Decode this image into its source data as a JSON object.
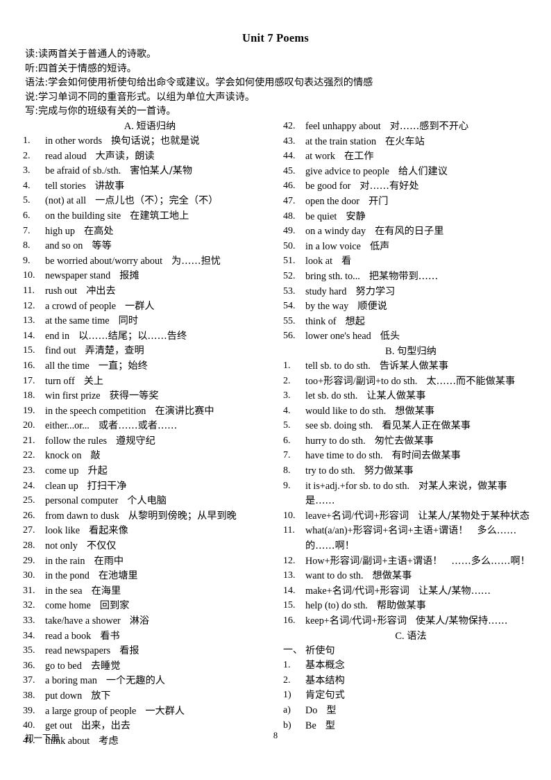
{
  "document": {
    "title": "Unit 7 Poems",
    "footer_left": "初一下册",
    "footer_page": "8"
  },
  "intro": [
    "读:读两首关于普通人的诗歌。",
    "听:四首关于情感的短诗。",
    "语法:学会如何使用祈使句给出命令或建议。学会如何使用感叹句表达强烈的情感",
    "说:学习单词不同的重音形式。以组为单位大声读诗。",
    "写:完成与你的班级有关的一首诗。"
  ],
  "section_a": {
    "heading_label": "A.",
    "heading_cn": "短语归纳",
    "items": [
      {
        "num": "1.",
        "en": "in other words",
        "cn": "换句话说；也就是说"
      },
      {
        "num": "2.",
        "en": "read aloud",
        "cn": "大声读，朗读"
      },
      {
        "num": "3.",
        "en": "be afraid of sb./sth.",
        "cn": "害怕某人/某物"
      },
      {
        "num": "4.",
        "en": "tell stories",
        "cn": "讲故事"
      },
      {
        "num": "5.",
        "en": "(not) at all",
        "cn": "一点儿也（不）；完全（不）"
      },
      {
        "num": "6.",
        "en": "on the building site",
        "cn": "在建筑工地上"
      },
      {
        "num": "7.",
        "en": "high up",
        "cn": "在高处"
      },
      {
        "num": "8.",
        "en": "and so on",
        "cn": "等等"
      },
      {
        "num": "9.",
        "en": "be worried about/worry about",
        "cn": "为……担忧"
      },
      {
        "num": "10.",
        "en": "newspaper stand",
        "cn": "报摊"
      },
      {
        "num": "11.",
        "en": "rush out",
        "cn": "冲出去"
      },
      {
        "num": "12.",
        "en": "a crowd of people",
        "cn": "一群人"
      },
      {
        "num": "13.",
        "en": "at the same time",
        "cn": "同时"
      },
      {
        "num": "14.",
        "en": "end in",
        "cn": "以……结尾；以……告终"
      },
      {
        "num": "15.",
        "en": "find out",
        "cn": "弄清楚，查明"
      },
      {
        "num": "16.",
        "en": "all the time",
        "cn": "一直；始终"
      },
      {
        "num": "17.",
        "en": "turn off",
        "cn": "关上"
      },
      {
        "num": "18.",
        "en": "win first prize",
        "cn": "获得一等奖"
      },
      {
        "num": "19.",
        "en": "in the speech competition",
        "cn": "在演讲比赛中"
      },
      {
        "num": "20.",
        "en": "either...or...",
        "cn": "或者……或者……"
      },
      {
        "num": "21.",
        "en": "follow the rules",
        "cn": "遵规守纪"
      },
      {
        "num": "22.",
        "en": "knock on",
        "cn": "敲"
      },
      {
        "num": "23.",
        "en": "come up",
        "cn": "升起"
      },
      {
        "num": "24.",
        "en": "clean up",
        "cn": "打扫干净"
      },
      {
        "num": "25.",
        "en": "personal computer",
        "cn": "个人电脑"
      },
      {
        "num": "26.",
        "en": "from dawn to dusk",
        "cn": "从黎明到傍晚；从早到晚"
      },
      {
        "num": "27.",
        "en": "look like",
        "cn": "看起来像"
      },
      {
        "num": "28.",
        "en": "not only",
        "cn": "不仅仅"
      },
      {
        "num": "29.",
        "en": "in the rain",
        "cn": "在雨中"
      },
      {
        "num": "30.",
        "en": "in the pond",
        "cn": "在池塘里"
      },
      {
        "num": "31.",
        "en": "in the sea",
        "cn": "在海里"
      },
      {
        "num": "32.",
        "en": "come home",
        "cn": "回到家"
      },
      {
        "num": "33.",
        "en": "take/have a shower",
        "cn": "淋浴"
      },
      {
        "num": "34.",
        "en": "read a book",
        "cn": "看书"
      },
      {
        "num": "35.",
        "en": "read newspapers",
        "cn": "看报"
      },
      {
        "num": "36.",
        "en": "go to bed",
        "cn": "去睡觉"
      },
      {
        "num": "37.",
        "en": "a boring man",
        "cn": "一个无趣的人"
      },
      {
        "num": "38.",
        "en": "put down",
        "cn": "放下"
      },
      {
        "num": "39.",
        "en": "a large group of people",
        "cn": "一大群人"
      },
      {
        "num": "40.",
        "en": "get out",
        "cn": "出来，出去"
      },
      {
        "num": "41.",
        "en": "think about",
        "cn": "考虑"
      },
      {
        "num": "42.",
        "en": "feel unhappy about",
        "cn": "对……感到不开心"
      },
      {
        "num": "43.",
        "en": "at the train station",
        "cn": "在火车站"
      },
      {
        "num": "44.",
        "en": "at work",
        "cn": "在工作"
      },
      {
        "num": "45.",
        "en": "give advice to people",
        "cn": "给人们建议"
      },
      {
        "num": "46.",
        "en": "be good for",
        "cn": "对……有好处"
      },
      {
        "num": "47.",
        "en": "open the door",
        "cn": "开门"
      },
      {
        "num": "48.",
        "en": "be quiet",
        "cn": "安静"
      },
      {
        "num": "49.",
        "en": "on a windy day",
        "cn": "在有风的日子里"
      },
      {
        "num": "50.",
        "en": "in a low voice",
        "cn": "低声"
      },
      {
        "num": "51.",
        "en": "look at",
        "cn": "看"
      },
      {
        "num": "52.",
        "en": "bring sth. to...",
        "cn": "把某物带到……"
      },
      {
        "num": "53.",
        "en": "study hard",
        "cn": "努力学习"
      },
      {
        "num": "54.",
        "en": "by the way",
        "cn": "顺便说"
      },
      {
        "num": "55.",
        "en": "think of",
        "cn": "想起"
      },
      {
        "num": "56.",
        "en": "lower one's head",
        "cn": "低头"
      }
    ]
  },
  "section_b": {
    "heading_label": "B.",
    "heading_cn": "句型归纳",
    "items": [
      {
        "num": "1.",
        "en": "tell sb. to do sth.",
        "cn": "告诉某人做某事"
      },
      {
        "num": "2.",
        "en": "too+形容词/副词+to do sth.",
        "cn": "太……而不能做某事"
      },
      {
        "num": "3.",
        "en": "let sb. do sth.",
        "cn": "让某人做某事"
      },
      {
        "num": "4.",
        "en": "would like to do sth.",
        "cn": "想做某事"
      },
      {
        "num": "5.",
        "en": "see sb. doing sth.",
        "cn": "看见某人正在做某事"
      },
      {
        "num": "6.",
        "en": "hurry to do sth.",
        "cn": "匆忙去做某事"
      },
      {
        "num": "7.",
        "en": "have time to do sth.",
        "cn": "有时间去做某事"
      },
      {
        "num": "8.",
        "en": "try to do sth.",
        "cn": "努力做某事"
      },
      {
        "num": "9.",
        "en": "it is+adj.+for sb. to do sth.",
        "cn": "对某人来说，做某事是……"
      },
      {
        "num": "10.",
        "en": "leave+名词/代词+形容词",
        "cn": "让某人/某物处于某种状态"
      },
      {
        "num": "11.",
        "en": "what(a/an)+形容词+名词+主语+谓语！",
        "cn": "多么……的……啊！"
      },
      {
        "num": "12.",
        "en": "How+形容词/副词+主语+谓语！",
        "cn": "……多么……啊！"
      },
      {
        "num": "13.",
        "en": "want to do sth.",
        "cn": "想做某事"
      },
      {
        "num": "14.",
        "en": "make+名词/代词+形容词",
        "cn": "让某人/某物……"
      },
      {
        "num": "15.",
        "en": "help (to) do sth.",
        "cn": "帮助做某事"
      },
      {
        "num": "16.",
        "en": "keep+名词/代词+形容词",
        "cn": "使某人/某物保持……"
      }
    ]
  },
  "section_c": {
    "heading_label": "C.",
    "heading_cn": "语法",
    "items": [
      {
        "num": "一、",
        "en": "",
        "cn": "祈使句"
      },
      {
        "num": "1.",
        "en": "",
        "cn": "基本概念"
      },
      {
        "num": "2.",
        "en": "",
        "cn": "基本结构"
      },
      {
        "num": "1)",
        "en": "",
        "cn": "肯定句式"
      },
      {
        "num": "a)",
        "en": "Do",
        "cn": "型"
      },
      {
        "num": "b)",
        "en": "Be",
        "cn": "型"
      }
    ]
  }
}
